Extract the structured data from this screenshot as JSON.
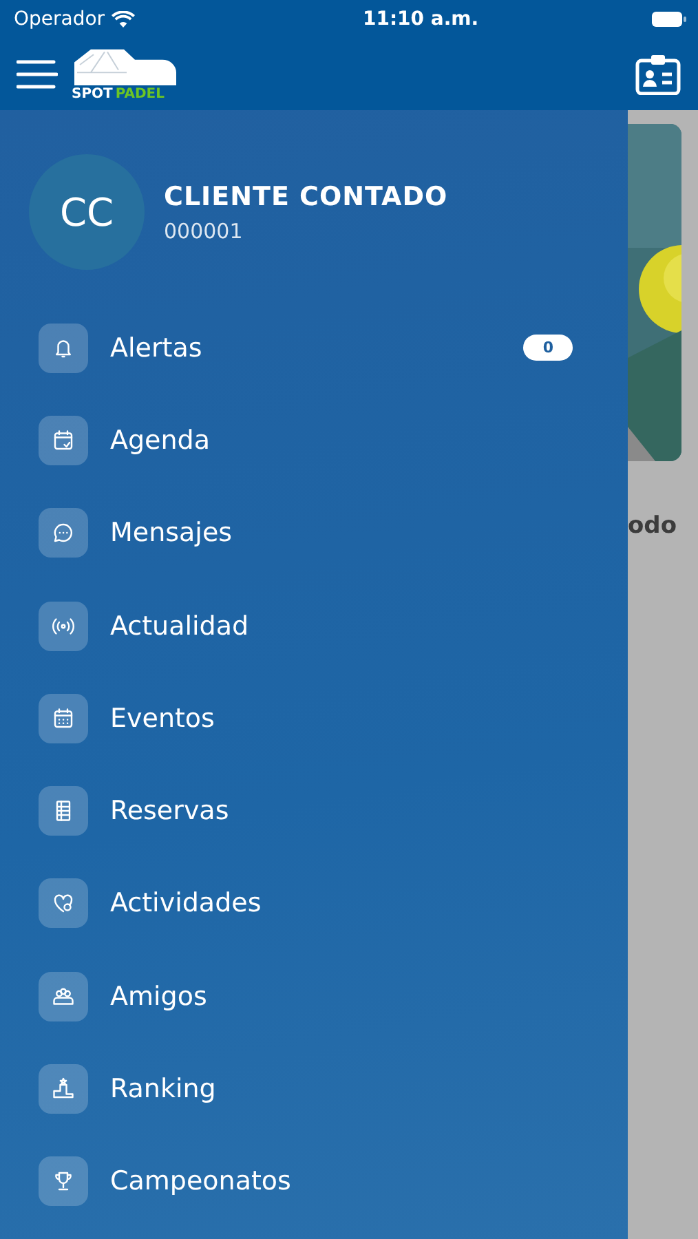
{
  "status_bar": {
    "carrier": "Operador",
    "time": "11:10 a.m."
  },
  "header": {
    "logo": {
      "part_1": "SPOT",
      "part_2": "PADEL"
    }
  },
  "background": {
    "caption": "odo"
  },
  "drawer": {
    "profile": {
      "initials": "CC",
      "name": "CLIENTE CONTADO",
      "code": "000001"
    },
    "items": [
      {
        "label": "Alertas",
        "badge": "0"
      },
      {
        "label": "Agenda"
      },
      {
        "label": "Mensajes"
      },
      {
        "label": "Actualidad"
      },
      {
        "label": "Eventos"
      },
      {
        "label": "Reservas"
      },
      {
        "label": "Actividades"
      },
      {
        "label": "Amigos"
      },
      {
        "label": "Ranking"
      },
      {
        "label": "Campeonatos"
      }
    ]
  }
}
